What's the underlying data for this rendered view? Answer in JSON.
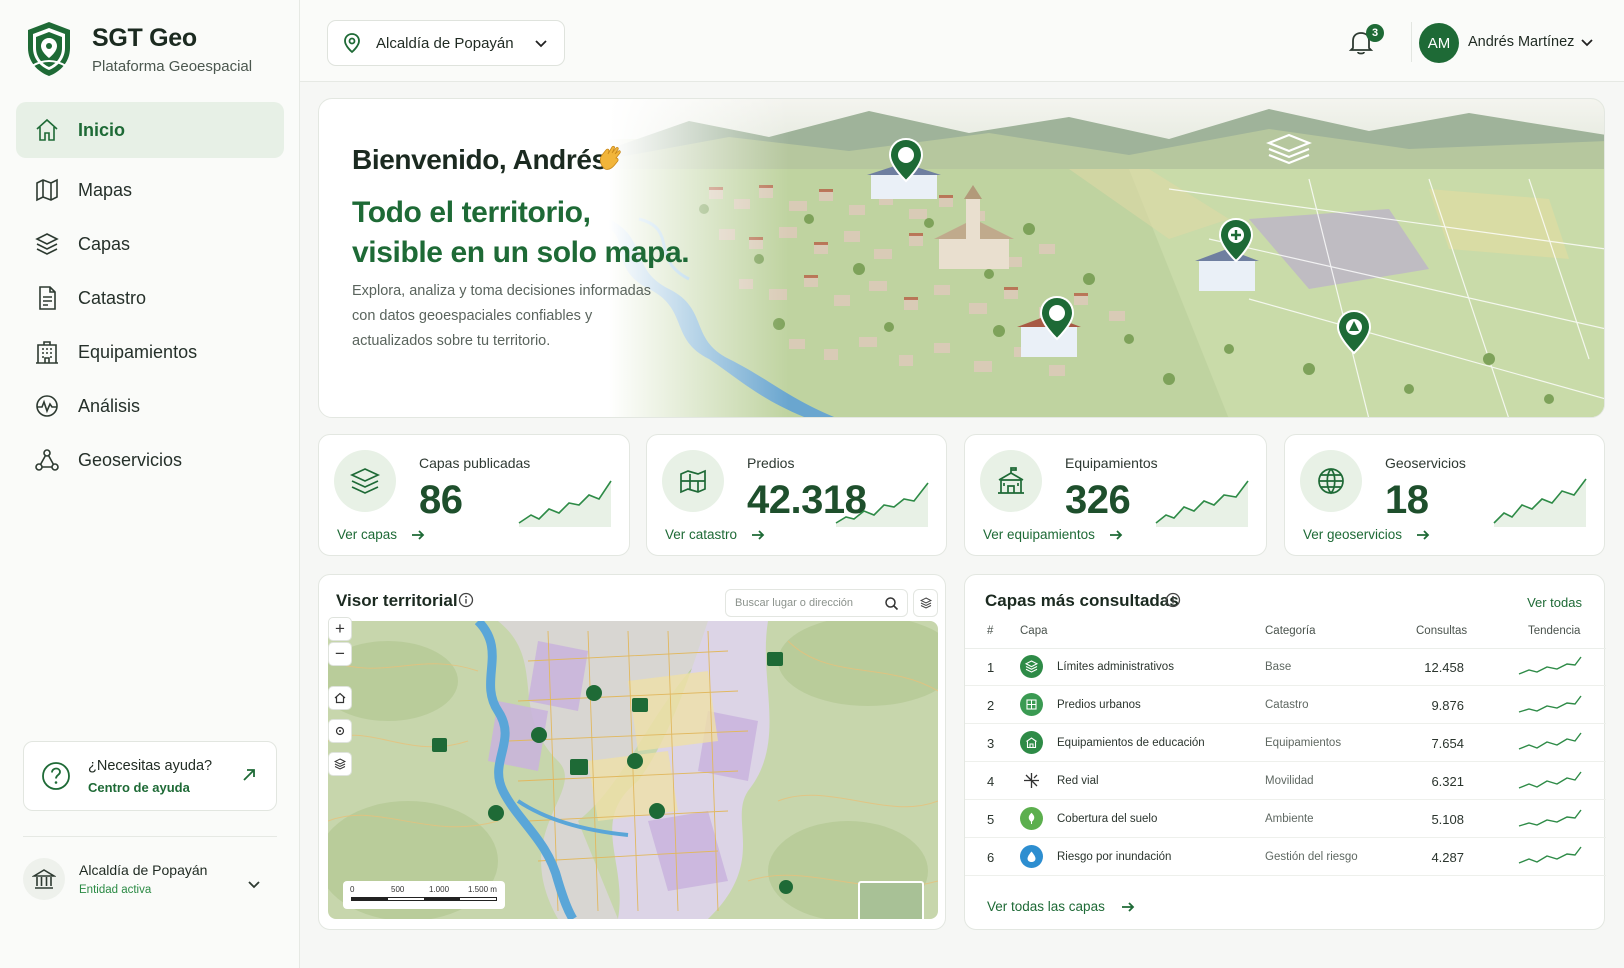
{
  "brand": {
    "title": "SGT Geo",
    "subtitle": "Plataforma Geoespacial"
  },
  "sidebar": {
    "items": [
      {
        "label": "Inicio",
        "icon": "home-icon",
        "active": true
      },
      {
        "label": "Mapas",
        "icon": "map-icon"
      },
      {
        "label": "Capas",
        "icon": "layers-icon"
      },
      {
        "label": "Catastro",
        "icon": "document-icon"
      },
      {
        "label": "Equipamientos",
        "icon": "building-icon"
      },
      {
        "label": "Análisis",
        "icon": "pulse-chart-icon"
      },
      {
        "label": "Geoservicios",
        "icon": "network-icon"
      }
    ],
    "help": {
      "title": "¿Necesitas ayuda?",
      "link": "Centro de ayuda"
    },
    "entity": {
      "name": "Alcaldía de Popayán",
      "status": "Entidad activa"
    }
  },
  "header": {
    "org": "Alcaldía de Popayán",
    "notifications": "3",
    "user_initials": "AM",
    "user_name": "Andrés Martínez"
  },
  "hero": {
    "greeting": "Bienvenido, Andrés",
    "headline_1": "Todo el territorio,",
    "headline_2": "visible en un solo mapa.",
    "body": "Explora, analiza y toma decisiones informadas con datos geoespaciales confiables y actualizados sobre tu territorio."
  },
  "kpis": [
    {
      "label": "Capas publicadas",
      "value": "86",
      "link": "Ver capas",
      "icon": "layers-icon"
    },
    {
      "label": "Predios",
      "value": "42.318",
      "link": "Ver catastro",
      "icon": "parcel-map-icon"
    },
    {
      "label": "Equipamientos",
      "value": "326",
      "link": "Ver equipamientos",
      "icon": "school-building-icon"
    },
    {
      "label": "Geoservicios",
      "value": "18",
      "link": "Ver geoservicios",
      "icon": "globe-icon"
    }
  ],
  "viewer": {
    "title": "Visor territorial",
    "search_placeholder": "Buscar lugar o dirección",
    "scale": [
      "0",
      "500",
      "1.000",
      "1.500 m"
    ]
  },
  "layers_table": {
    "title": "Capas más consultadas",
    "view_all": "Ver todas",
    "columns": [
      "#",
      "Capa",
      "Categoría",
      "Consultas",
      "Tendencia"
    ],
    "rows": [
      {
        "n": "1",
        "name": "Límites administrativos",
        "category": "Base",
        "count": "12.458",
        "color": "#2e8b47"
      },
      {
        "n": "2",
        "name": "Predios urbanos",
        "category": "Catastro",
        "count": "9.876",
        "color": "#3a9a52"
      },
      {
        "n": "3",
        "name": "Equipamientos de educación",
        "category": "Equipamientos",
        "count": "7.654",
        "color": "#2e8b47"
      },
      {
        "n": "4",
        "name": "Red vial",
        "category": "Movilidad",
        "count": "6.321",
        "color": "#ffffff"
      },
      {
        "n": "5",
        "name": "Cobertura del suelo",
        "category": "Ambiente",
        "count": "5.108",
        "color": "#5caf4e"
      },
      {
        "n": "6",
        "name": "Riesgo por inundación",
        "category": "Gestión del riesgo",
        "count": "4.287",
        "color": "#2d8ed0"
      }
    ],
    "footer_link": "Ver todas las capas"
  },
  "colors": {
    "accent": "#1e6a36",
    "accent_light": "#e7f0e6",
    "water": "#5aa6d8"
  }
}
